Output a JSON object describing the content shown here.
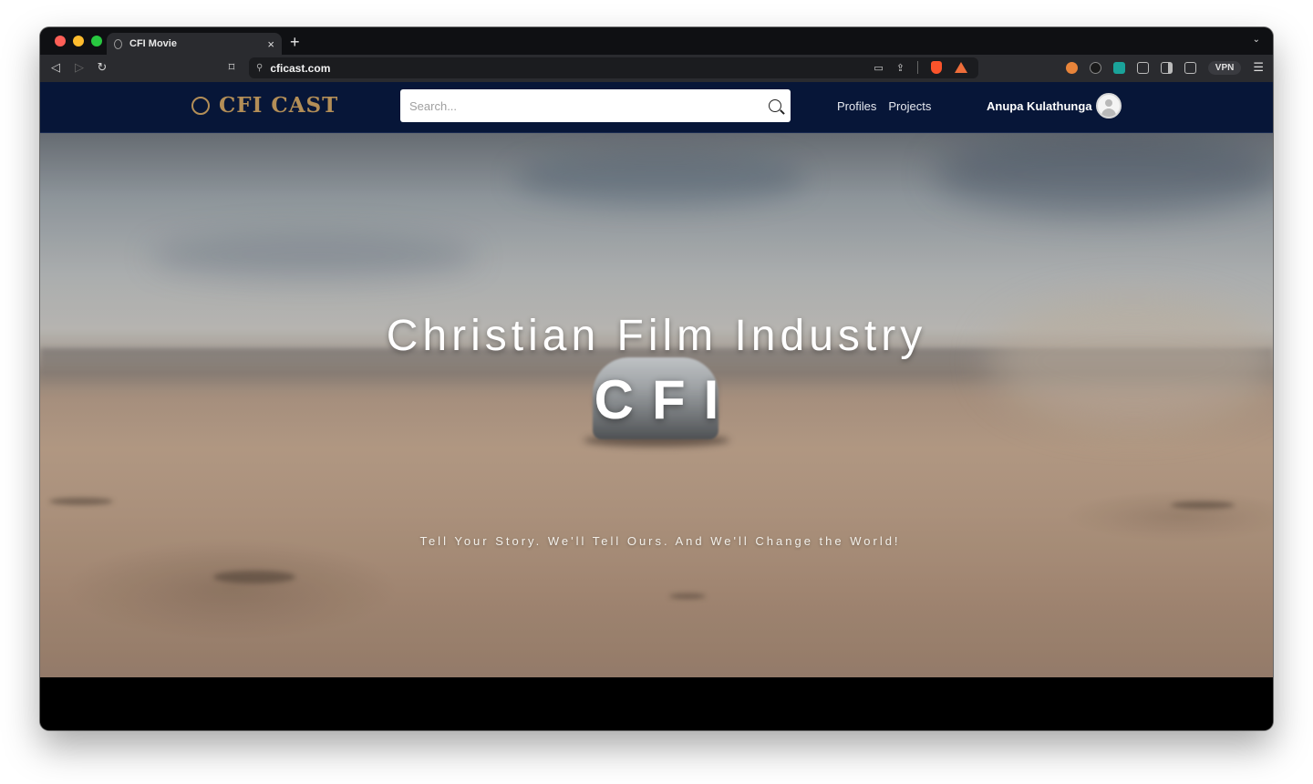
{
  "browser": {
    "tab_title": "CFI Movie",
    "tab_close": "×",
    "new_tab": "+",
    "url": "cficast.com",
    "vpn_label": "VPN"
  },
  "site": {
    "logo_text": "CFI CAST",
    "search_placeholder": "Search...",
    "nav": [
      "Profiles",
      "Projects"
    ],
    "user_name": "Anupa Kulathunga"
  },
  "hero": {
    "title": "Christian Film Industry",
    "acronym": "CFI",
    "tagline": "Tell Your Story. We'll Tell Ours. And We'll Change the World!"
  },
  "colors": {
    "header_bg": "#071638",
    "logo_gold": "#b38e57"
  }
}
